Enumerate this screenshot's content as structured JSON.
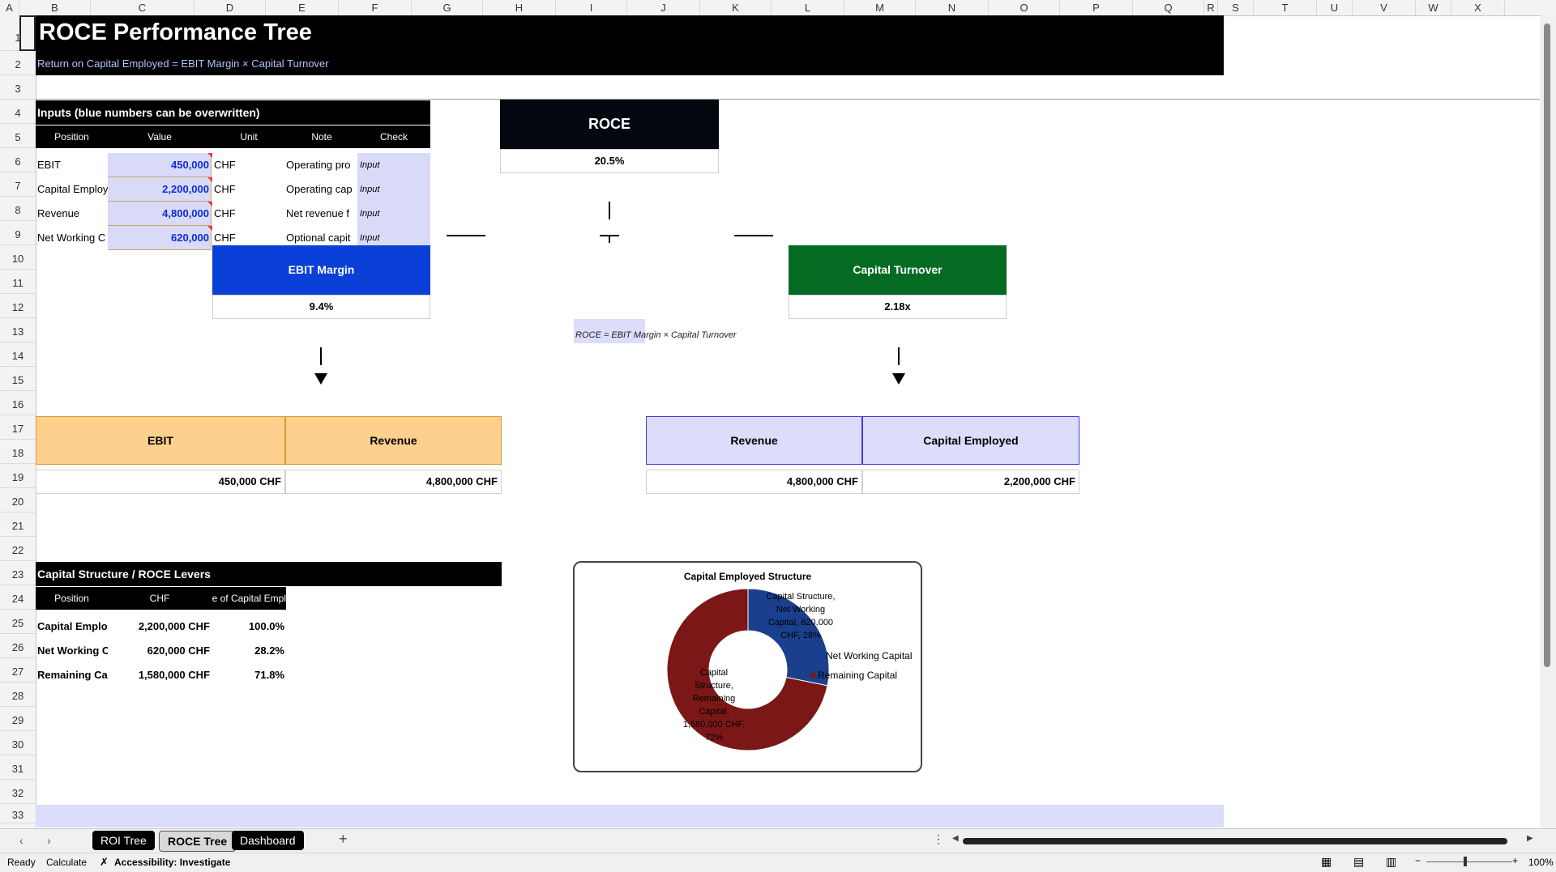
{
  "columns": [
    "A",
    "B",
    "C",
    "D",
    "E",
    "F",
    "G",
    "H",
    "I",
    "J",
    "K",
    "L",
    "M",
    "N",
    "O",
    "P",
    "Q",
    "R",
    "S",
    "T",
    "U",
    "V",
    "W",
    "X"
  ],
  "rows": [
    "1",
    "2",
    "3",
    "4",
    "5",
    "6",
    "7",
    "8",
    "9",
    "10",
    "11",
    "12",
    "13",
    "14",
    "15",
    "16",
    "17",
    "18",
    "19",
    "20",
    "21",
    "22",
    "23",
    "24",
    "25",
    "26",
    "27",
    "28",
    "29",
    "30",
    "31",
    "32",
    "33"
  ],
  "title": "ROCE Performance Tree",
  "subtitle": "Return on Capital Employed = EBIT Margin × Capital Turnover",
  "inputs": {
    "heading": "Inputs (blue numbers can be overwritten)",
    "headers": [
      "Position",
      "Value",
      "Unit",
      "Note",
      "Check"
    ],
    "rows": [
      {
        "position": "EBIT",
        "value": "450,000",
        "unit": "CHF",
        "note": "Operating pro",
        "check": "Input"
      },
      {
        "position": "Capital Employ",
        "value": "2,200,000",
        "unit": "CHF",
        "note": "Operating cap",
        "check": "Input"
      },
      {
        "position": "Revenue",
        "value": "4,800,000",
        "unit": "CHF",
        "note": "Net revenue f",
        "check": "Input"
      },
      {
        "position": "Net Working C",
        "value": "620,000",
        "unit": "CHF",
        "note": "Optional capit",
        "check": "Input"
      }
    ]
  },
  "roce": {
    "label": "ROCE",
    "value": "20.5%"
  },
  "ebit_margin": {
    "label": "EBIT Margin",
    "value": "9.4%"
  },
  "capital_turnover": {
    "label": "Capital Turnover",
    "value": "2.18x"
  },
  "formula": "ROCE = EBIT Margin × Capital Turnover",
  "left_branch": {
    "h1": "EBIT",
    "h2": "Revenue",
    "v1": "450,000 CHF",
    "v2": "4,800,000 CHF"
  },
  "right_branch": {
    "h1": "Revenue",
    "h2": "Capital Employed",
    "v1": "4,800,000 CHF",
    "v2": "2,200,000 CHF"
  },
  "capital_structure": {
    "heading": "Capital Structure / ROCE Levers",
    "headers": [
      "Position",
      "CHF",
      "e of Capital Empl"
    ],
    "rows": [
      {
        "position": "Capital Emplo",
        "chf": "2,200,000 CHF",
        "pct": "100.0%"
      },
      {
        "position": "Net Working C",
        "chf": "620,000 CHF",
        "pct": "28.2%"
      },
      {
        "position": "Remaining Cap",
        "chf": "1,580,000 CHF",
        "pct": "71.8%"
      }
    ]
  },
  "chart_data": {
    "type": "pie",
    "title": "Capital Employed Structure",
    "categories": [
      "Net Working Capital",
      "Remaining Capital"
    ],
    "values": [
      620000,
      1580000
    ],
    "colors": [
      "#1a3f8c",
      "#7c1717"
    ],
    "data_labels": [
      "Capital Structure, Net Working Capital, 620,000 CHF, 28%",
      "Capital Structure, Remaining Capital, 1,580,000 CHF, 72%"
    ],
    "legend": [
      "Net Working Capital",
      "Remaining Capital"
    ],
    "legend_position": "right"
  },
  "sheet_tabs": [
    "ROI Tree",
    "ROCE Tree",
    "Dashboard"
  ],
  "add_sheet": "+",
  "status": {
    "ready": "Ready",
    "calculate": "Calculate",
    "accessibility": "Accessibility: Investigate",
    "zoom": "100%"
  }
}
